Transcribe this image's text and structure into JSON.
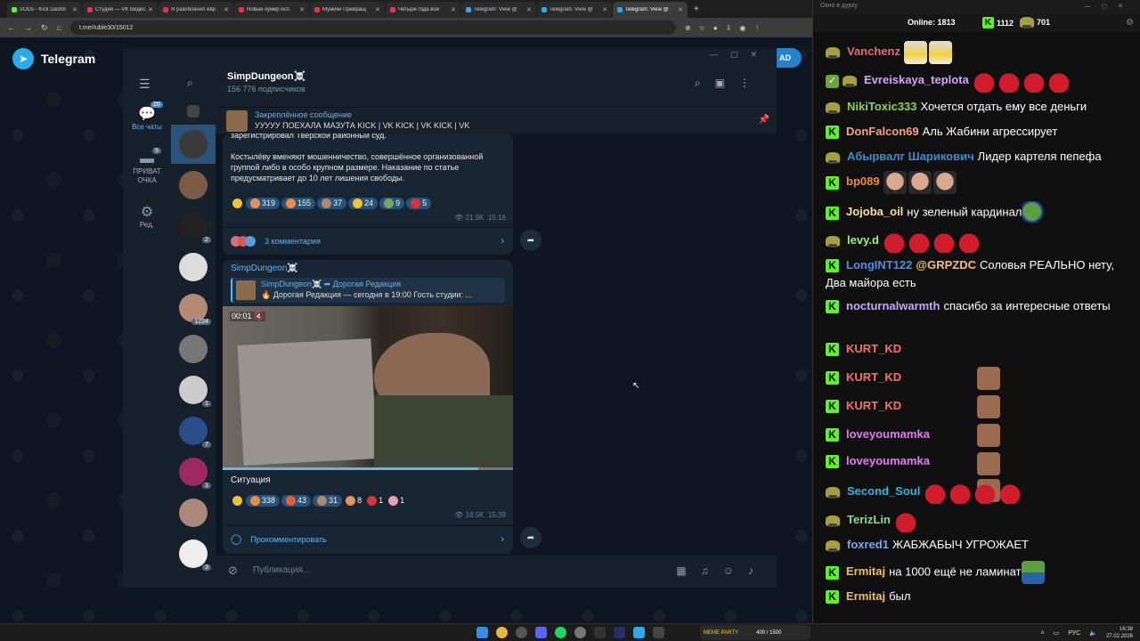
{
  "browser": {
    "tabs": [
      {
        "title": "VODs - Kick Dashb",
        "color": "#53fc18"
      },
      {
        "title": "Студия — VK Видео",
        "color": "#e8304b"
      },
      {
        "title": "Я разоблачил евр",
        "color": "#e8304b"
      },
      {
        "title": "Новый кумир исп",
        "color": "#e8304b"
      },
      {
        "title": "Мужики Превращ",
        "color": "#e8304b"
      },
      {
        "title": "Четыре года вой",
        "color": "#e8304b"
      },
      {
        "title": "Telegram: View @",
        "color": "#2aabee"
      },
      {
        "title": "Telegram: View @",
        "color": "#2aabee"
      },
      {
        "title": "Telegram: View @",
        "color": "#2aabee",
        "active": true
      }
    ],
    "url": "t.me/ruble30/15012"
  },
  "telegram_web": {
    "brand": "Telegram",
    "download_label": "AD"
  },
  "sidebar": {
    "folders": [
      {
        "label": "Все чаты",
        "badge": "20",
        "active": true
      },
      {
        "label": "ПРИВАТ ОЧКА",
        "badge": "5"
      },
      {
        "label": "Ред."
      }
    ]
  },
  "chat_list_badges": [
    "2",
    "1224",
    "1",
    "7",
    "1",
    "3"
  ],
  "channel": {
    "title": "SimpDungeon☠️",
    "subscribers": "156 776 подписчиков"
  },
  "pinned": {
    "title": "Закреплённое сообщение",
    "text": "УУУУУ ПОЕХАЛА МАЗУТА  KICK | VK KICK | VK KICK | VK"
  },
  "post1": {
    "text_top": "зарегистрировал Тверской районный суд.",
    "text_body": "Костылёву вменяют мошенничество, совершённое организованной группой либо в особо крупном размере. Наказание по статье предусматривает до 10 лет лишения свободы.",
    "reactions": [
      "319",
      "155",
      "37",
      "24",
      "9",
      "5"
    ],
    "views": "21.9K",
    "time": "15:16",
    "comments": "3 комментария"
  },
  "post2": {
    "author": "SimpDungeon☠️",
    "fwd_from": "SimpDungeon☠️ ➦ Дорогая Редакция",
    "fwd_text": "🔥 Дорогая Редакция — сегодня в 19:00  Гость студии: ...",
    "timecode": "00:01",
    "caption": "Ситуация",
    "reactions": [
      "338",
      "43",
      "31",
      "8",
      "1",
      "1"
    ],
    "views": "18.5K",
    "time": "15:39",
    "comment_label": "Прокомментировать"
  },
  "composer": {
    "placeholder": "Публикация..."
  },
  "chat_window": {
    "title": "Окно в дурку",
    "online_label": "Online:",
    "online": "1813",
    "kick_count": "1112",
    "other_count": "701",
    "messages": [
      {
        "user": "Vanchenz",
        "color": "#e06c75",
        "badge": "frog",
        "text": "",
        "emotes": [
          "shrek",
          "shrek"
        ]
      },
      {
        "user": "Evreiskaya_teplota",
        "color": "#d8a0ff",
        "badge": "sword+frog",
        "text": "",
        "emotes": [
          "red",
          "red",
          "red",
          "red"
        ]
      },
      {
        "user": "NikiToxic333",
        "color": "#8fd14f",
        "badge": "frog",
        "text": "Хочется отдать ему все деньги",
        "emotes": []
      },
      {
        "user": "DonFalcon69",
        "color": "#ff9e80",
        "badge": "kick",
        "text": "Аль Жабини агрессирует",
        "emotes": []
      },
      {
        "user": "Абырвалг Шарикович",
        "color": "#3d8bd6",
        "badge": "frog",
        "text": "Лидер картеля пепефа",
        "emotes": []
      },
      {
        "user": "bp089",
        "color": "#f08a3c",
        "badge": "kick",
        "text": "",
        "emotes": [
          "bald",
          "bald",
          "bald"
        ]
      },
      {
        "user": "Jojoba_oil",
        "color": "#f6e38a",
        "badge": "kick",
        "text": "ну зеленый кардинал",
        "emotes": [
          "pepe"
        ]
      },
      {
        "user": "levy.d",
        "color": "#9ef07a",
        "badge": "frog",
        "text": "",
        "emotes": [
          "red",
          "red",
          "red",
          "red"
        ]
      },
      {
        "user": "LongINT122",
        "color": "#4d8ee8",
        "badge": "kick",
        "mention": "@GRPZDC",
        "text": "Соловья РЕАЛЬНО нету, Два майора есть",
        "emotes": []
      },
      {
        "user": "nocturnalwarmth",
        "color": "#c3a6ff",
        "badge": "kick",
        "text": "спасибо за интересные ответы",
        "emotes": []
      },
      {
        "user": "KURT_KD",
        "color": "#ff6b6b",
        "badge": "kick",
        "text": "",
        "emotes": [
          "face"
        ]
      },
      {
        "user": "KURT_KD",
        "color": "#ff6b6b",
        "badge": "kick",
        "text": "",
        "emotes": [
          "face"
        ]
      },
      {
        "user": "KURT_KD",
        "color": "#ff6b6b",
        "badge": "kick",
        "text": "",
        "emotes": [
          "face"
        ]
      },
      {
        "user": "loveyoumamka",
        "color": "#e879f9",
        "badge": "kick",
        "text": "",
        "emotes": [
          "face"
        ]
      },
      {
        "user": "loveyoumamka",
        "color": "#e879f9",
        "badge": "kick",
        "text": "",
        "emotes": [
          "face"
        ]
      },
      {
        "user": "Second_Soul",
        "color": "#2fb5e0",
        "badge": "frog",
        "text": "",
        "emotes": [
          "red",
          "red",
          "red",
          "red"
        ]
      },
      {
        "user": "TerizLin",
        "color": "#7fe08b",
        "badge": "frog",
        "text": "",
        "emotes": [
          "red"
        ]
      },
      {
        "user": "foxred1",
        "color": "#6ea8ff",
        "badge": "frog",
        "text": "ЖАБЖАБЫЧ УГРОЖАЕТ",
        "emotes": []
      },
      {
        "user": "Ermitaj",
        "color": "#f0c04a",
        "badge": "kick",
        "text": "на 1000 ещё не ламинат",
        "emotes": [
          "flag"
        ]
      },
      {
        "user": "Ermitaj",
        "color": "#f0c04a",
        "badge": "kick",
        "text": "был",
        "emotes": []
      }
    ]
  },
  "taskbar": {
    "ad_label": "MEME PARTY",
    "ad_counter": "400 / 1500",
    "lang": "РУС",
    "time": "16:38",
    "date": "27.02.2026"
  }
}
